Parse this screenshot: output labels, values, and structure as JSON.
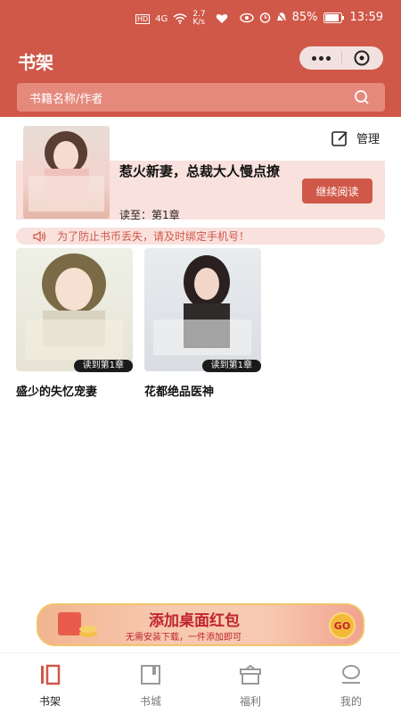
{
  "status": {
    "network": "4G",
    "speed": "2.7 K/s",
    "battery": "85%",
    "time": "13:59"
  },
  "header": {
    "title": "书架",
    "search_placeholder": "书籍名称/作者"
  },
  "toolbar": {
    "manage_label": "管理"
  },
  "recent": {
    "title": "惹火新妻，总裁大人慢点撩",
    "read_to": "读至：第1章",
    "continue_label": "继续阅读"
  },
  "notice": {
    "text": "为了防止书币丢失，请及时绑定手机号！"
  },
  "books": [
    {
      "name": "盛少的失忆宠妻",
      "badge": "读到第1章"
    },
    {
      "name": "花都绝品医神",
      "badge": "读到第1章"
    }
  ],
  "banner": {
    "title": "添加桌面红包",
    "subtitle": "无需安装下载，一件添加即可",
    "go": "GO"
  },
  "tabs": [
    {
      "label": "书架",
      "icon": "bookshelf-icon",
      "active": true
    },
    {
      "label": "书城",
      "icon": "bookstore-icon"
    },
    {
      "label": "福利",
      "icon": "gift-icon"
    },
    {
      "label": "我的",
      "icon": "profile-icon"
    }
  ],
  "colors": {
    "accent": "#d05848",
    "soft": "#f9e1dd"
  }
}
